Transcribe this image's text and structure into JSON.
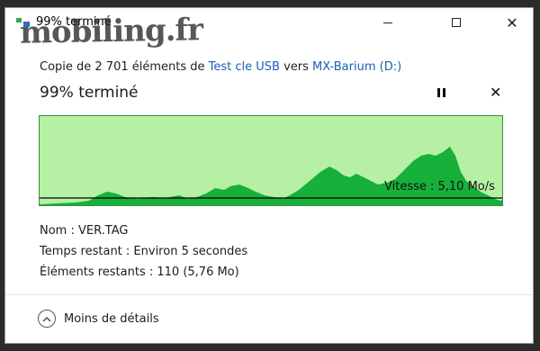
{
  "window": {
    "title": "99% terminé",
    "icons": {
      "app": "file-copy-icon",
      "minimize": "minimize-icon",
      "maximize": "maximize-icon",
      "close": "close-icon"
    }
  },
  "copy": {
    "prefix": "Copie de 2 701 éléments de ",
    "source": "Test cle USB",
    "middle": " vers ",
    "destination": "MX-Barium (D:)"
  },
  "progress": {
    "title": "99% terminé",
    "percent": 99,
    "speed": "Vitesse : 5,10 Mo/s",
    "colors": {
      "fill": "#16b03a",
      "background": "#b6f0a4",
      "line": "#000000"
    }
  },
  "details": {
    "name": "Nom :  VER.TAG",
    "time_remaining": "Temps restant :  Environ 5 secondes",
    "items_remaining": "Éléments restants :  110 (5,76 Mo)"
  },
  "footer": {
    "toggle_label": "Moins de détails"
  },
  "watermark": "mobiling.fr"
}
